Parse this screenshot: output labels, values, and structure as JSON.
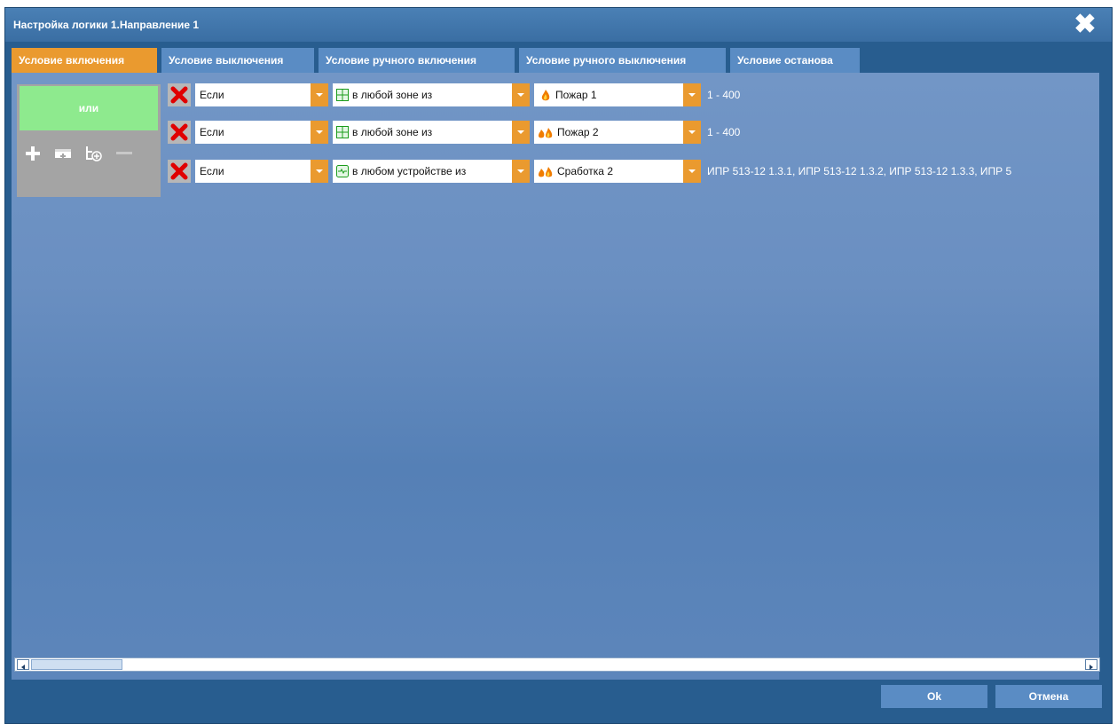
{
  "window": {
    "title": "Настройка логики 1.Направление 1",
    "close_icon": "close-icon"
  },
  "tabs": [
    {
      "label": "Условие включения",
      "active": true
    },
    {
      "label": "Условие выключения",
      "active": false
    },
    {
      "label": "Условие ручного включения",
      "active": false
    },
    {
      "label": "Условие ручного выключения",
      "active": false
    },
    {
      "label": "Условие останова",
      "active": false
    }
  ],
  "operator_panel": {
    "label": "или",
    "tools": [
      "plus-icon",
      "add-block-icon",
      "add-subcondition-icon",
      "minus-icon"
    ]
  },
  "conditions": [
    {
      "if_label": "Если",
      "scope_label": "в любой зоне из",
      "scope_icon": "zone-grid-icon",
      "state_label": "Пожар 1",
      "state_icon": "fire-icon",
      "objects": "1 - 400"
    },
    {
      "if_label": "Если",
      "scope_label": "в любой зоне из",
      "scope_icon": "zone-grid-icon",
      "state_label": "Пожар 2",
      "state_icon": "fire-double-icon",
      "objects": "1 - 400"
    },
    {
      "if_label": "Если",
      "scope_label": "в любом устройстве из",
      "scope_icon": "device-icon",
      "state_label": "Сработка 2",
      "state_icon": "fire-double-icon",
      "objects": "ИПР 513-12 1.3.1, ИПР 513-12 1.3.2, ИПР 513-12 1.3.3, ИПР 5"
    }
  ],
  "footer": {
    "ok_label": "Ok",
    "cancel_label": "Отмена"
  },
  "colors": {
    "accent": "#ea9a2f",
    "operator": "#8eea8e",
    "delete": "#e00000",
    "tab": "#5a8cc4"
  }
}
